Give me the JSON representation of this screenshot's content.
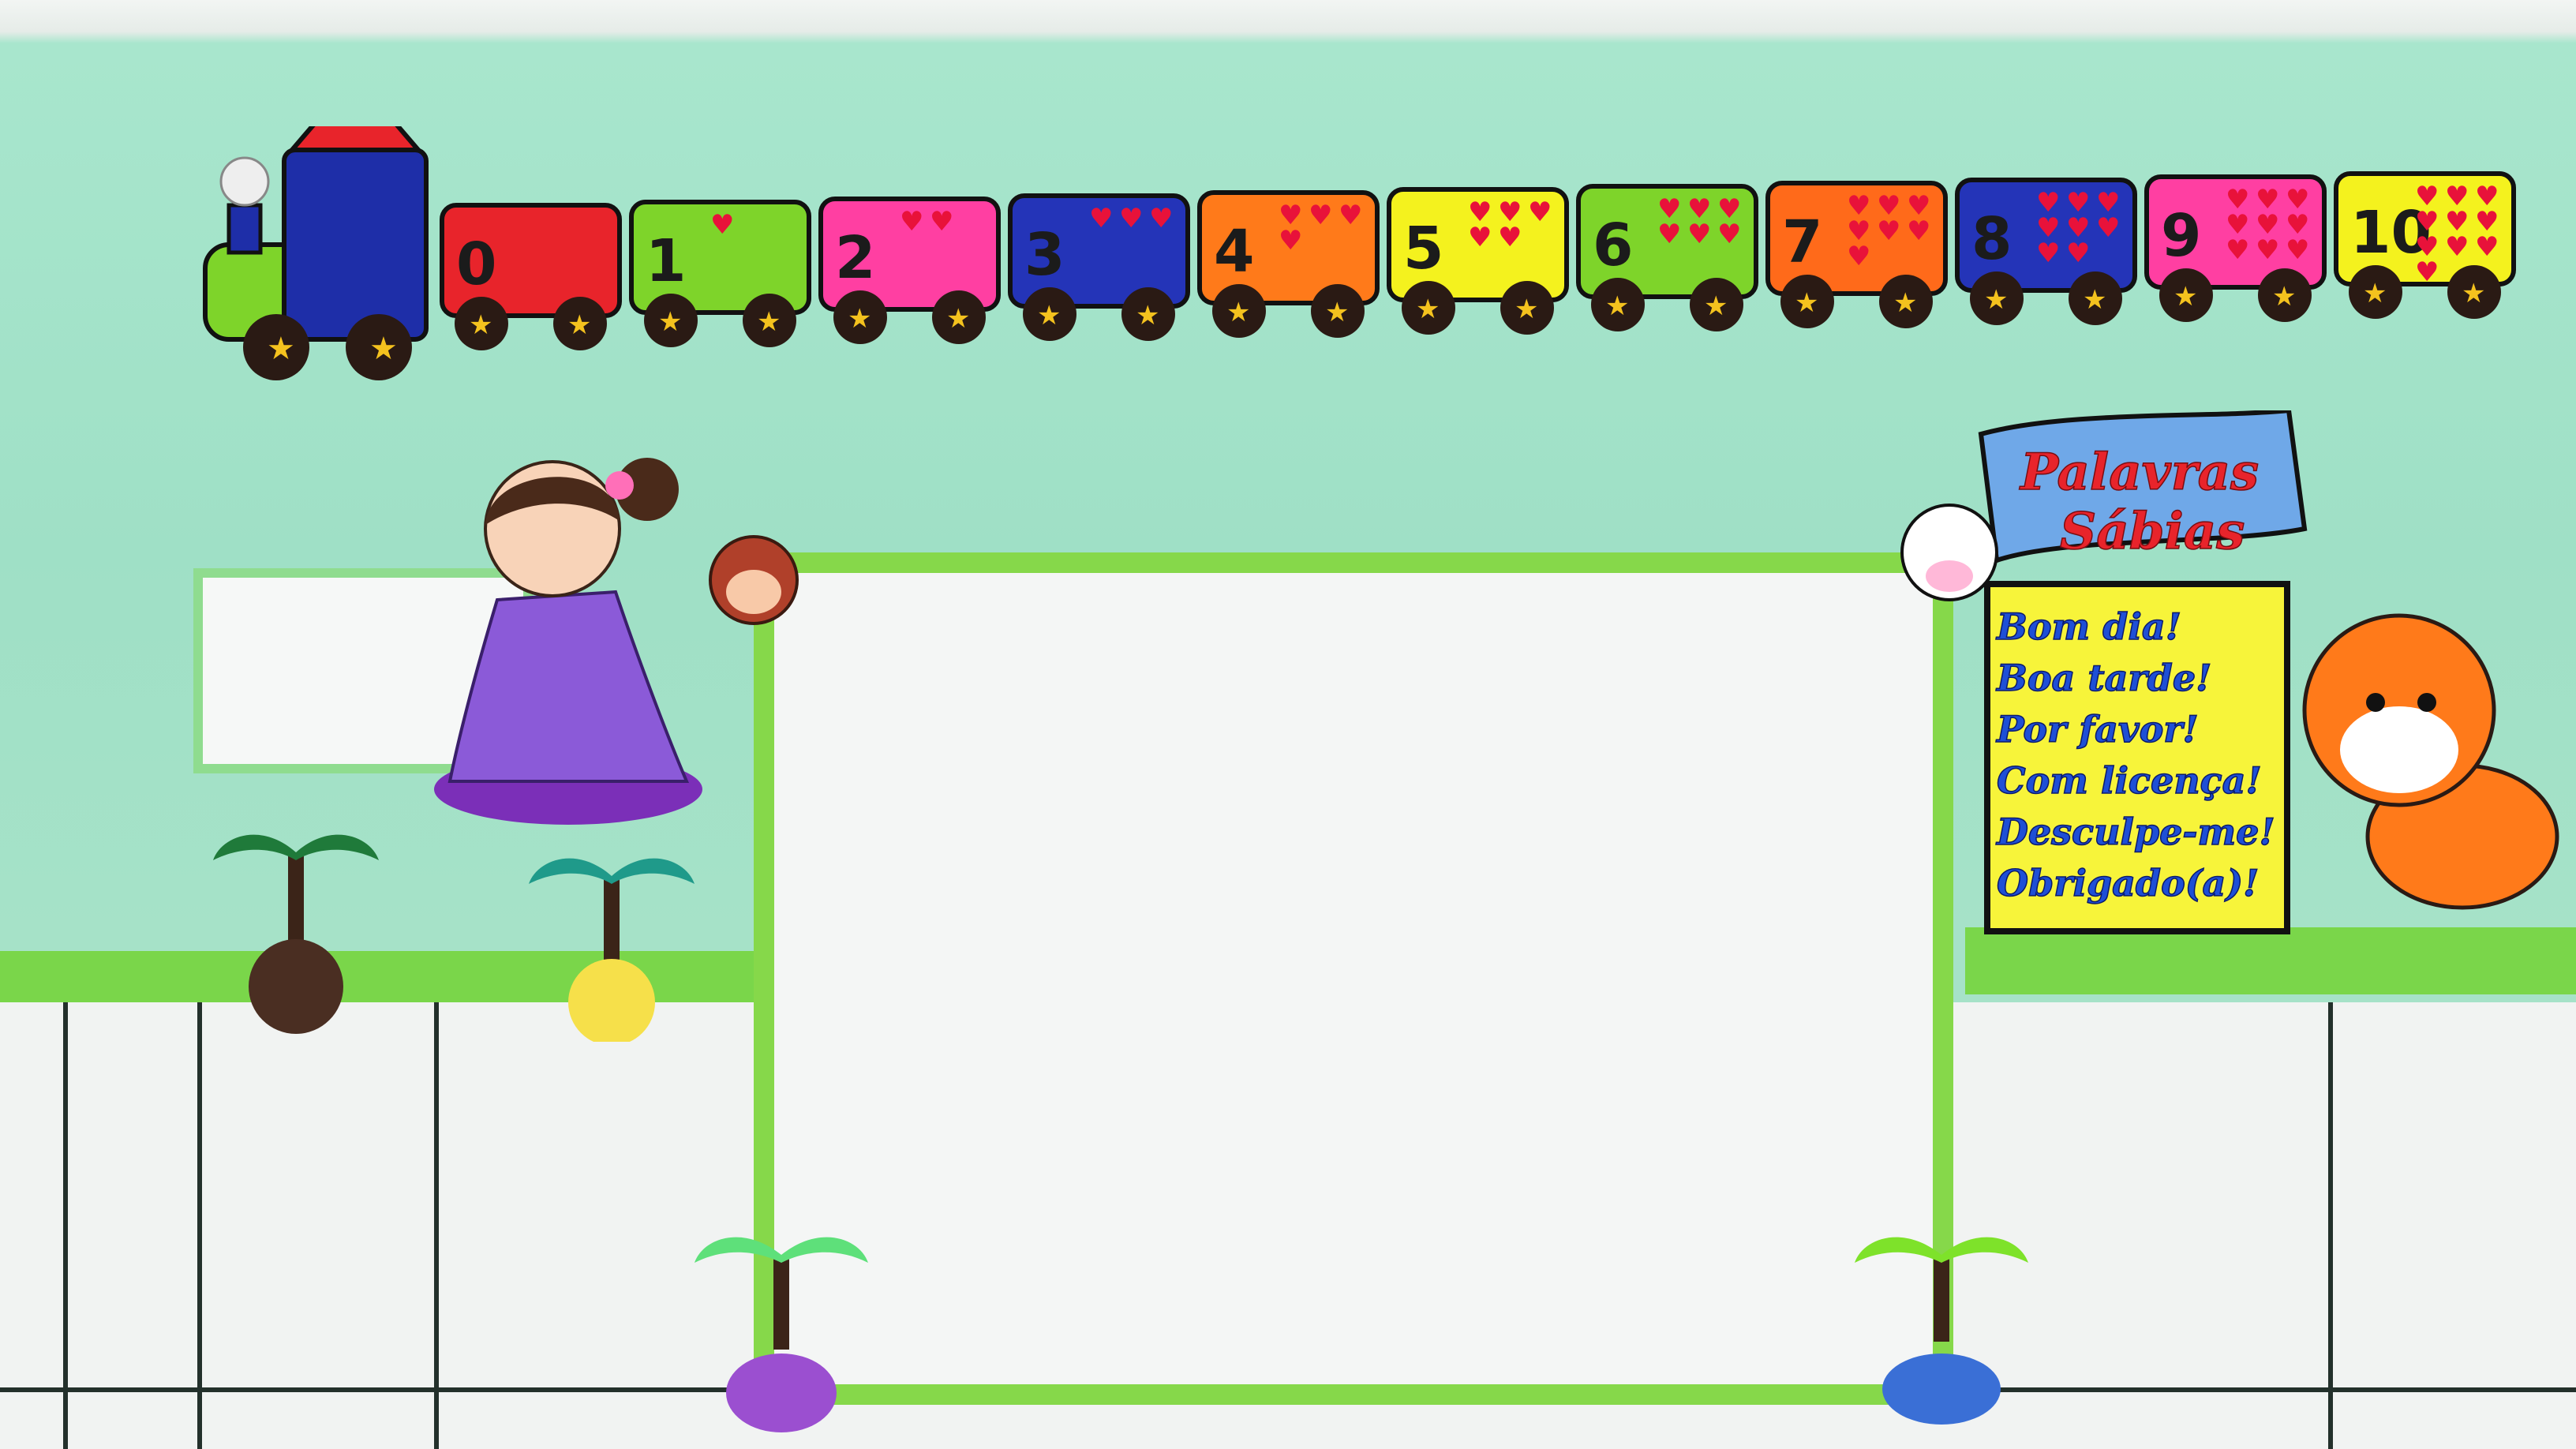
{
  "scene": {
    "colors": {
      "wall": "#9fe0c6",
      "tile": "#f1f3f2",
      "grass": "#7ad64a",
      "board_frame": "#86d84a",
      "sign_banner": "#6fa8e8",
      "sign_body": "#f7f43a",
      "sign_text": "#1e4fd6"
    }
  },
  "train": {
    "wagon_numbers": [
      "0",
      "1",
      "2",
      "3",
      "4",
      "5",
      "6",
      "7",
      "8",
      "9",
      "10"
    ],
    "wagon_colors": [
      "#e8242b",
      "#7ed42a",
      "#ff3fa2",
      "#2434b8",
      "#ff7a1a",
      "#f4f21e",
      "#7ed42a",
      "#ff6a1a",
      "#2434b8",
      "#ff3fa2",
      "#f4f21e"
    ]
  },
  "sign": {
    "title_line1": "Palavras",
    "title_line2": "Sábias",
    "lines": [
      "Bom dia!",
      "Boa tarde!",
      "Por favor!",
      "Com licença!",
      "Desculpe-me!",
      "Obrigado(a)!"
    ]
  },
  "decor_icons": [
    "monkey-icon",
    "hippo-icon",
    "bear-icon",
    "lion-icon",
    "giraffe-icon",
    "elephant-icon",
    "zebra-icon",
    "tiger-icon",
    "palm-tree-icon",
    "praying-girl-icon"
  ]
}
